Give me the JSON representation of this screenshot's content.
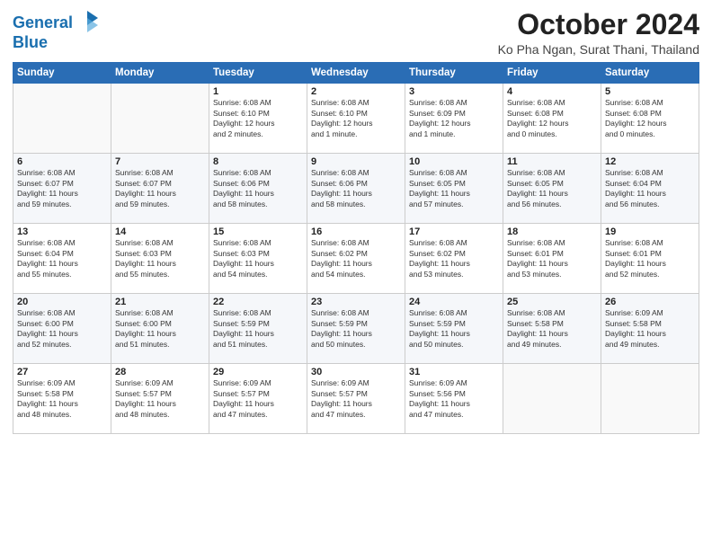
{
  "header": {
    "logo_line1": "General",
    "logo_line2": "Blue",
    "month": "October 2024",
    "location": "Ko Pha Ngan, Surat Thani, Thailand"
  },
  "weekdays": [
    "Sunday",
    "Monday",
    "Tuesday",
    "Wednesday",
    "Thursday",
    "Friday",
    "Saturday"
  ],
  "weeks": [
    [
      {
        "day": "",
        "info": ""
      },
      {
        "day": "",
        "info": ""
      },
      {
        "day": "1",
        "info": "Sunrise: 6:08 AM\nSunset: 6:10 PM\nDaylight: 12 hours\nand 2 minutes."
      },
      {
        "day": "2",
        "info": "Sunrise: 6:08 AM\nSunset: 6:10 PM\nDaylight: 12 hours\nand 1 minute."
      },
      {
        "day": "3",
        "info": "Sunrise: 6:08 AM\nSunset: 6:09 PM\nDaylight: 12 hours\nand 1 minute."
      },
      {
        "day": "4",
        "info": "Sunrise: 6:08 AM\nSunset: 6:08 PM\nDaylight: 12 hours\nand 0 minutes."
      },
      {
        "day": "5",
        "info": "Sunrise: 6:08 AM\nSunset: 6:08 PM\nDaylight: 12 hours\nand 0 minutes."
      }
    ],
    [
      {
        "day": "6",
        "info": "Sunrise: 6:08 AM\nSunset: 6:07 PM\nDaylight: 11 hours\nand 59 minutes."
      },
      {
        "day": "7",
        "info": "Sunrise: 6:08 AM\nSunset: 6:07 PM\nDaylight: 11 hours\nand 59 minutes."
      },
      {
        "day": "8",
        "info": "Sunrise: 6:08 AM\nSunset: 6:06 PM\nDaylight: 11 hours\nand 58 minutes."
      },
      {
        "day": "9",
        "info": "Sunrise: 6:08 AM\nSunset: 6:06 PM\nDaylight: 11 hours\nand 58 minutes."
      },
      {
        "day": "10",
        "info": "Sunrise: 6:08 AM\nSunset: 6:05 PM\nDaylight: 11 hours\nand 57 minutes."
      },
      {
        "day": "11",
        "info": "Sunrise: 6:08 AM\nSunset: 6:05 PM\nDaylight: 11 hours\nand 56 minutes."
      },
      {
        "day": "12",
        "info": "Sunrise: 6:08 AM\nSunset: 6:04 PM\nDaylight: 11 hours\nand 56 minutes."
      }
    ],
    [
      {
        "day": "13",
        "info": "Sunrise: 6:08 AM\nSunset: 6:04 PM\nDaylight: 11 hours\nand 55 minutes."
      },
      {
        "day": "14",
        "info": "Sunrise: 6:08 AM\nSunset: 6:03 PM\nDaylight: 11 hours\nand 55 minutes."
      },
      {
        "day": "15",
        "info": "Sunrise: 6:08 AM\nSunset: 6:03 PM\nDaylight: 11 hours\nand 54 minutes."
      },
      {
        "day": "16",
        "info": "Sunrise: 6:08 AM\nSunset: 6:02 PM\nDaylight: 11 hours\nand 54 minutes."
      },
      {
        "day": "17",
        "info": "Sunrise: 6:08 AM\nSunset: 6:02 PM\nDaylight: 11 hours\nand 53 minutes."
      },
      {
        "day": "18",
        "info": "Sunrise: 6:08 AM\nSunset: 6:01 PM\nDaylight: 11 hours\nand 53 minutes."
      },
      {
        "day": "19",
        "info": "Sunrise: 6:08 AM\nSunset: 6:01 PM\nDaylight: 11 hours\nand 52 minutes."
      }
    ],
    [
      {
        "day": "20",
        "info": "Sunrise: 6:08 AM\nSunset: 6:00 PM\nDaylight: 11 hours\nand 52 minutes."
      },
      {
        "day": "21",
        "info": "Sunrise: 6:08 AM\nSunset: 6:00 PM\nDaylight: 11 hours\nand 51 minutes."
      },
      {
        "day": "22",
        "info": "Sunrise: 6:08 AM\nSunset: 5:59 PM\nDaylight: 11 hours\nand 51 minutes."
      },
      {
        "day": "23",
        "info": "Sunrise: 6:08 AM\nSunset: 5:59 PM\nDaylight: 11 hours\nand 50 minutes."
      },
      {
        "day": "24",
        "info": "Sunrise: 6:08 AM\nSunset: 5:59 PM\nDaylight: 11 hours\nand 50 minutes."
      },
      {
        "day": "25",
        "info": "Sunrise: 6:08 AM\nSunset: 5:58 PM\nDaylight: 11 hours\nand 49 minutes."
      },
      {
        "day": "26",
        "info": "Sunrise: 6:09 AM\nSunset: 5:58 PM\nDaylight: 11 hours\nand 49 minutes."
      }
    ],
    [
      {
        "day": "27",
        "info": "Sunrise: 6:09 AM\nSunset: 5:58 PM\nDaylight: 11 hours\nand 48 minutes."
      },
      {
        "day": "28",
        "info": "Sunrise: 6:09 AM\nSunset: 5:57 PM\nDaylight: 11 hours\nand 48 minutes."
      },
      {
        "day": "29",
        "info": "Sunrise: 6:09 AM\nSunset: 5:57 PM\nDaylight: 11 hours\nand 47 minutes."
      },
      {
        "day": "30",
        "info": "Sunrise: 6:09 AM\nSunset: 5:57 PM\nDaylight: 11 hours\nand 47 minutes."
      },
      {
        "day": "31",
        "info": "Sunrise: 6:09 AM\nSunset: 5:56 PM\nDaylight: 11 hours\nand 47 minutes."
      },
      {
        "day": "",
        "info": ""
      },
      {
        "day": "",
        "info": ""
      }
    ]
  ]
}
